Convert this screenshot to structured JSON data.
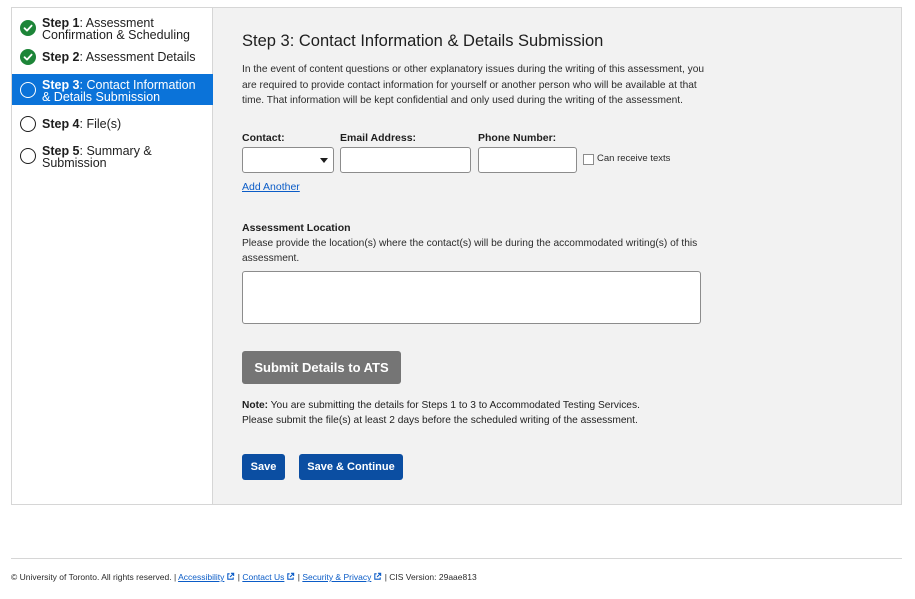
{
  "sidebar": {
    "steps": [
      {
        "num": "Step 1",
        "title": ": Assessment Confirmation & Scheduling",
        "status": "complete",
        "icon": "check-circle-icon"
      },
      {
        "num": "Step 2",
        "title": ": Assessment Details",
        "status": "complete",
        "icon": "check-circle-icon"
      },
      {
        "num": "Step 3",
        "title": ": Contact Information & Details Submission",
        "status": "active",
        "icon": "circle-icon"
      },
      {
        "num": "Step 4",
        "title": ": File(s)",
        "status": "todo",
        "icon": "circle-icon"
      },
      {
        "num": "Step 5",
        "title": ": Summary & Submission",
        "status": "todo",
        "icon": "circle-icon"
      }
    ]
  },
  "main": {
    "title": "Step 3: Contact Information & Details Submission",
    "intro": "In the event of content questions or other explanatory issues during the writing of this assessment, you are required to provide contact information for yourself or another person who will be available at that time. That information will be kept confidential and only used during the writing of the assessment.",
    "contact_label": "Contact:",
    "contact_value": "",
    "email_label": "Email Address:",
    "email_value": "",
    "phone_label": "Phone Number:",
    "phone_value": "",
    "texts_label": "Can receive texts",
    "add_another": "Add Another",
    "location_title": "Assessment Location",
    "location_desc": "Please provide the location(s) where the contact(s) will be during the accommodated writing(s) of this assessment.",
    "location_value": "",
    "submit_label": "Submit Details to ATS",
    "note_bold": "Note:",
    "note_line1": " You are submitting the details for Steps 1 to 3 to Accommodated Testing Services.",
    "note_line2": "Please submit the file(s) at least 2 days before the scheduled writing of the assessment.",
    "save_label": "Save",
    "save_continue_label": "Save & Continue"
  },
  "footer": {
    "copyright": "© University of Toronto. All rights reserved. |",
    "accessibility": "Accessibility",
    "contact_us": "Contact Us",
    "security": "Security & Privacy",
    "version": "| CIS Version: 29aae813",
    "sep": "|"
  },
  "colors": {
    "complete": "#1d8538",
    "active": "#0b73d9",
    "primary_button": "#0b4ea2",
    "disabled_button": "#757575",
    "link": "#0b5cc7"
  }
}
